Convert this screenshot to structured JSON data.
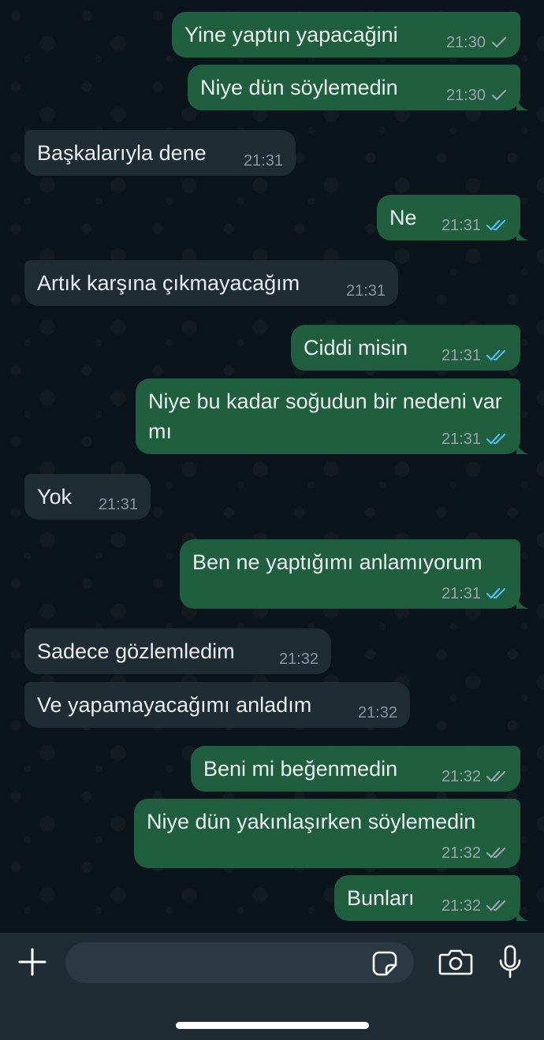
{
  "chat": {
    "messages": [
      {
        "dir": "out",
        "text": "Yine yaptın yapacağini",
        "time": "21:30",
        "status": "sent"
      },
      {
        "dir": "out",
        "text": "Niye dün söylemedin",
        "time": "21:30",
        "status": "sent"
      },
      {
        "dir": "in",
        "text": "Başkalarıyla dene",
        "time": "21:31"
      },
      {
        "dir": "out",
        "text": "Ne",
        "time": "21:31",
        "status": "read"
      },
      {
        "dir": "in",
        "text": "Artık karşına çıkmayacağım",
        "time": "21:31"
      },
      {
        "dir": "out",
        "text": "Ciddi misin",
        "time": "21:31",
        "status": "read"
      },
      {
        "dir": "out",
        "text": "Niye bu kadar soğudun bir nedeni var mı",
        "time": "21:31",
        "status": "read"
      },
      {
        "dir": "in",
        "text": "Yok",
        "time": "21:31"
      },
      {
        "dir": "out",
        "text": "Ben ne yaptığımı anlamıyorum",
        "time": "21:31",
        "status": "read"
      },
      {
        "dir": "in",
        "text": "Sadece gözlemledim",
        "time": "21:32"
      },
      {
        "dir": "in",
        "text": "Ve yapamayacağımı anladım",
        "time": "21:32"
      },
      {
        "dir": "out",
        "text": "Beni mi beğenmedin",
        "time": "21:32",
        "status": "delivered"
      },
      {
        "dir": "out",
        "text": "Niye dün yakınlaşırken söylemedin",
        "time": "21:32",
        "status": "delivered"
      },
      {
        "dir": "out",
        "text": "Bunları",
        "time": "21:32",
        "status": "delivered"
      }
    ]
  },
  "colors": {
    "background": "#0b141a",
    "outgoing_bubble": "#1f5e3e",
    "incoming_bubble": "#202c33",
    "read_tick": "#53bdeb",
    "unread_tick": "#9aa5ab",
    "composer": "#1f2c34"
  },
  "composer": {
    "input_value": "",
    "icons": [
      "plus-icon",
      "sticker-icon",
      "camera-icon",
      "microphone-icon"
    ]
  }
}
